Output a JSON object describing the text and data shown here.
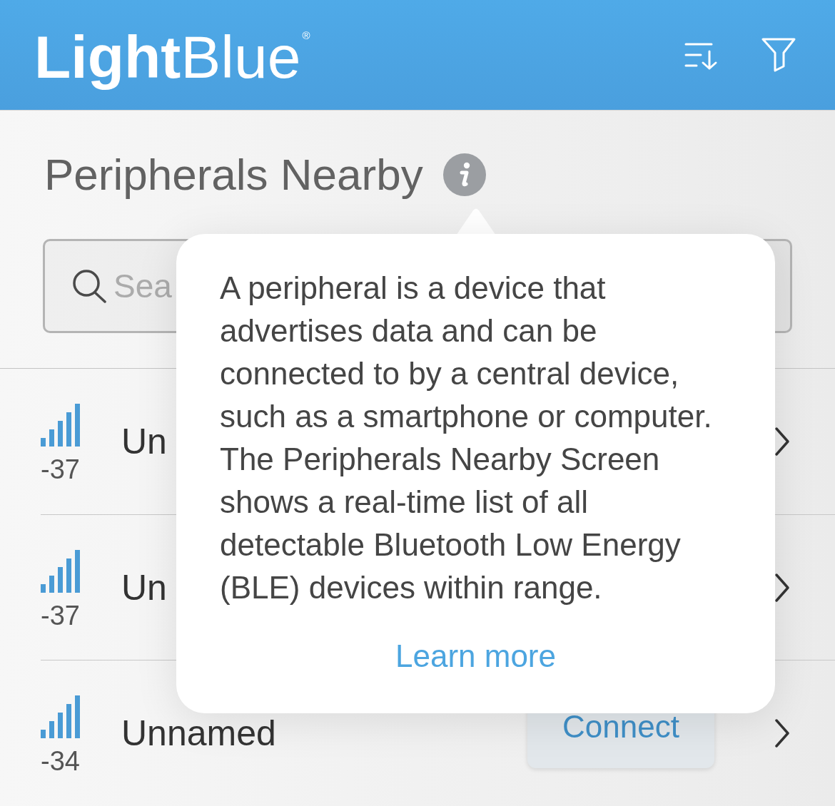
{
  "header": {
    "logo": "**Light**Blue$^{®}$"
  },
  "section": {
    "title": "Peripherals Nearby"
  },
  "search": {
    "placeholder": "Sea"
  },
  "devices": [
    {
      "rssi": "-37",
      "name": "Un"
    },
    {
      "rssi": "-37",
      "name": "Un"
    },
    {
      "rssi": "-34",
      "name": "Unnamed",
      "button": "Connect"
    }
  ],
  "popover": {
    "text": "A peripheral is a device that advertises data and can be connected to by a central device, such as a smartphone or computer. The Peripherals Nearby Screen shows a real-time list of all detectable Bluetooth Low Energy (BLE) devices within range.",
    "link": "Learn more"
  }
}
